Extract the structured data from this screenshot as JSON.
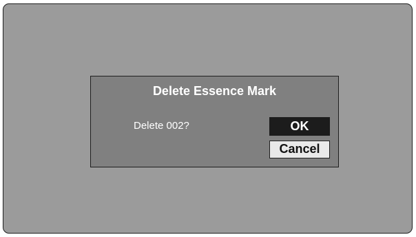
{
  "dialog": {
    "title": "Delete Essence Mark",
    "message": "Delete 002?",
    "ok_label": "OK",
    "cancel_label": "Cancel"
  },
  "colors": {
    "screen_background": "#9b9b9b",
    "dialog_background": "#808080",
    "ok_button_background": "#1c1c1c",
    "cancel_button_background": "#e9e9e9",
    "text": "#ffffff"
  }
}
